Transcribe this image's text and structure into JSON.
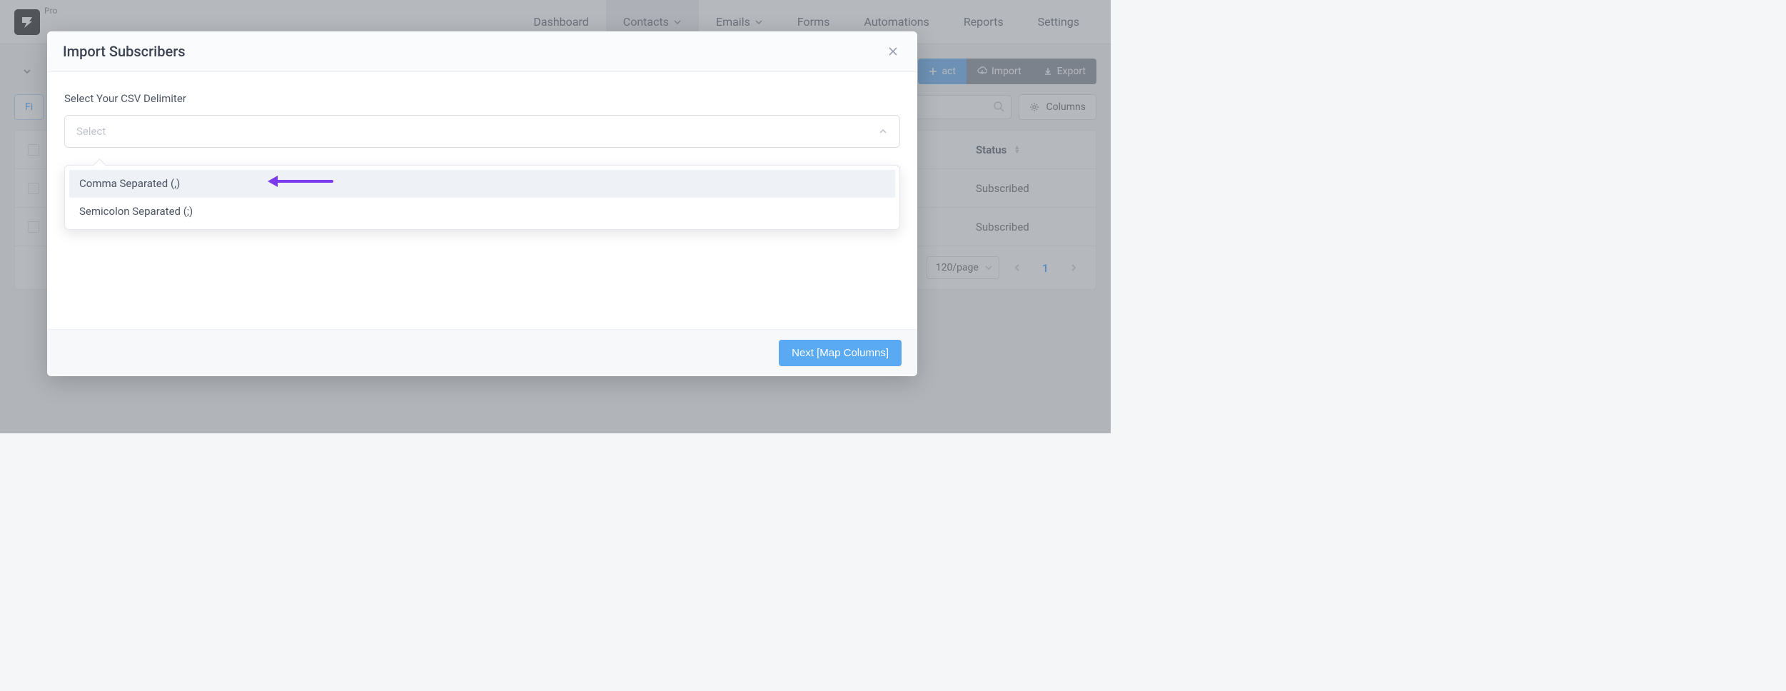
{
  "brand": {
    "tag": "Pro"
  },
  "nav": {
    "dashboard": "Dashboard",
    "contacts": "Contacts",
    "emails": "Emails",
    "forms": "Forms",
    "automations": "Automations",
    "reports": "Reports",
    "settings": "Settings"
  },
  "actions": {
    "add_contact_partial": "act",
    "import": "Import",
    "export": "Export",
    "filter_partial": "Fi",
    "columns": "Columns"
  },
  "search": {
    "placeholder": "..."
  },
  "table": {
    "status_header": "Status",
    "rows": [
      {
        "status": "Subscribed"
      },
      {
        "status": "Subscribed"
      }
    ]
  },
  "pagination": {
    "page_size": "120/page",
    "current": "1"
  },
  "modal": {
    "title": "Import Subscribers",
    "field_label": "Select Your CSV Delimiter",
    "select_placeholder": "Select",
    "options": {
      "comma": "Comma Separated (,)",
      "semicolon": "Semicolon Separated (;)"
    },
    "next": "Next [Map Columns]"
  }
}
